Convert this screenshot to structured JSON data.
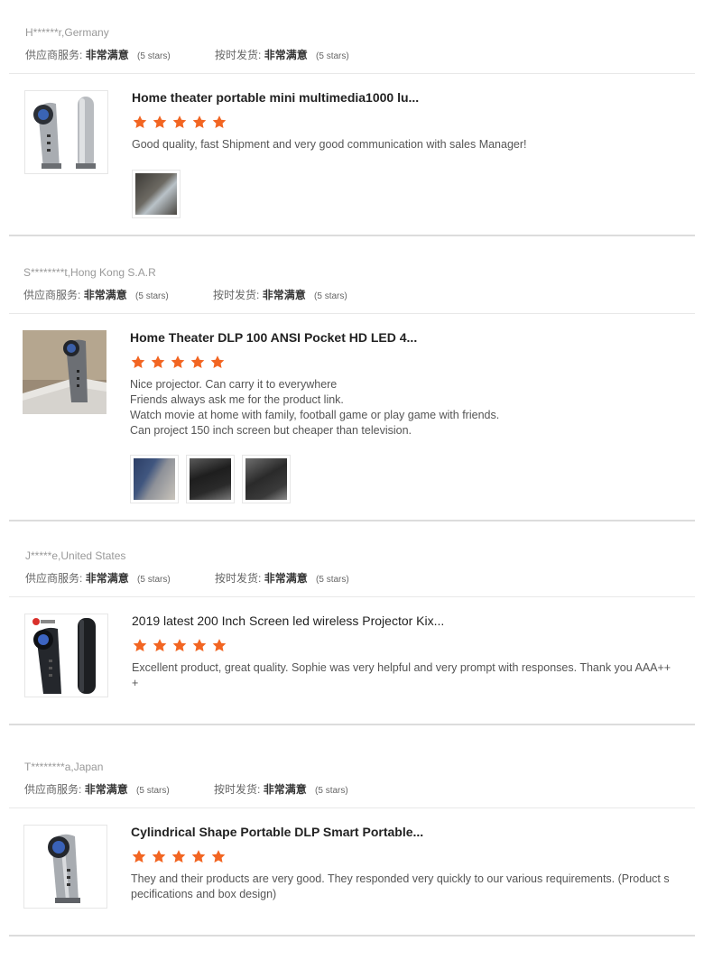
{
  "labels": {
    "supplier_service": "供应商服务:",
    "on_time_delivery": "按时发货:",
    "very_satisfied": "非常满意",
    "five_stars": "(5 stars)"
  },
  "accent_color": "#f26522",
  "reviews": [
    {
      "reviewer": "H******r,Germany",
      "product_title": "Home theater portable mini multimedia1000 lu...",
      "rating": 5,
      "comment_lines": [
        "Good quality, fast Shipment and very good communication with sales Manager!"
      ],
      "thumbnail_count": 1
    },
    {
      "reviewer": "S********t,Hong Kong S.A.R",
      "product_title": "Home Theater DLP 100 ANSI Pocket HD LED 4...",
      "rating": 5,
      "comment_lines": [
        "Nice projector. Can carry it to everywhere",
        "Friends always ask me for the product link.",
        "Watch movie at home with family, football game or play game with friends.",
        "Can project 150 inch screen but cheaper than television."
      ],
      "thumbnail_count": 3
    },
    {
      "reviewer": "J*****e,United States",
      "product_title": "2019 latest 200 Inch Screen led wireless Projector Kix...",
      "rating": 5,
      "comment_lines": [
        "Excellent product, great quality. Sophie was very helpful and very prompt with responses. Thank you AAA++",
        "+"
      ],
      "thumbnail_count": 0
    },
    {
      "reviewer": "T********a,Japan",
      "product_title": "Cylindrical Shape Portable DLP Smart Portable...",
      "rating": 5,
      "comment_lines": [
        "They and their products are very good. They responded very quickly to our various requirements. (Product s",
        "pecifications and box design)"
      ],
      "thumbnail_count": 0
    }
  ]
}
